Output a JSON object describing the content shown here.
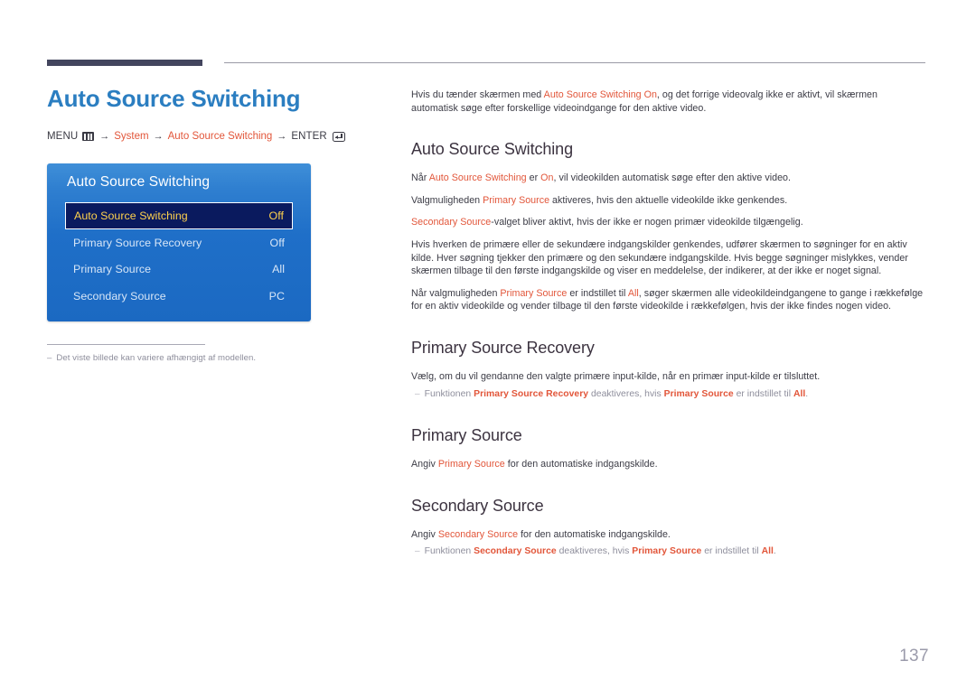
{
  "page_title": "Auto Source Switching",
  "breadcrumb": {
    "menu_label": "MENU",
    "menu_icon": "menu-bars-icon",
    "arrow": "→",
    "item1": "System",
    "item2": "Auto Source Switching",
    "enter_label": "ENTER",
    "enter_icon": "enter-return-icon"
  },
  "osd": {
    "title": "Auto Source Switching",
    "rows": [
      {
        "label": "Auto Source Switching",
        "value": "Off",
        "selected": true
      },
      {
        "label": "Primary Source Recovery",
        "value": "Off",
        "selected": false
      },
      {
        "label": "Primary Source",
        "value": "All",
        "selected": false
      },
      {
        "label": "Secondary Source",
        "value": "PC",
        "selected": false
      }
    ]
  },
  "footnote": {
    "dash": "‒",
    "text": "Det viste billede kan variere afhængigt af modellen."
  },
  "intro": {
    "p1_a": "Hvis du tænder skærmen med ",
    "p1_red": "Auto Source Switching On",
    "p1_b": ", og det forrige videovalg ikke er aktivt, vil skærmen automatisk søge efter forskellige videoindgange for den aktive video."
  },
  "sections": {
    "auto_source_switching": {
      "heading": "Auto Source Switching",
      "p1_a": "Når ",
      "p1_red1": "Auto Source Switching",
      "p1_b": " er ",
      "p1_red2": "On",
      "p1_c": ", vil videokilden automatisk søge efter den aktive video.",
      "p2_a": "Valgmuligheden ",
      "p2_red": "Primary Source",
      "p2_b": " aktiveres, hvis den aktuelle videokilde ikke genkendes.",
      "p3_red": "Secondary Source",
      "p3_b": "-valget bliver aktivt, hvis der ikke er nogen primær videokilde tilgængelig.",
      "p4": "Hvis hverken de primære eller de sekundære indgangskilder genkendes, udfører skærmen to søgninger for en aktiv kilde. Hver søgning tjekker den primære og den sekundære indgangskilde. Hvis begge søgninger mislykkes, vender skærmen tilbage til den første indgangskilde og viser en meddelelse, der indikerer, at der ikke er noget signal.",
      "p5_a": "Når valgmuligheden ",
      "p5_red1": "Primary Source",
      "p5_b": " er indstillet til ",
      "p5_red2": "All",
      "p5_c": ", søger skærmen alle videokildeindgangene to gange i rækkefølge for en aktiv videokilde og vender tilbage til den første videokilde i rækkefølgen, hvis der ikke findes nogen video."
    },
    "primary_source_recovery": {
      "heading": "Primary Source Recovery",
      "p1": "Vælg, om du vil gendanne den valgte primære input-kilde, når en primær input-kilde er tilsluttet.",
      "note_dash": "‒",
      "note_a": "Funktionen ",
      "note_red1": "Primary Source Recovery",
      "note_b": " deaktiveres, hvis ",
      "note_red2": "Primary Source",
      "note_c": " er indstillet til ",
      "note_red3": "All",
      "note_d": "."
    },
    "primary_source": {
      "heading": "Primary Source",
      "p1_a": "Angiv ",
      "p1_red": "Primary Source",
      "p1_b": " for den automatiske indgangskilde."
    },
    "secondary_source": {
      "heading": "Secondary Source",
      "p1_a": "Angiv ",
      "p1_red": "Secondary Source",
      "p1_b": " for den automatiske indgangskilde.",
      "note_dash": "‒",
      "note_a": "Funktionen ",
      "note_red1": "Secondary Source",
      "note_b": " deaktiveres, hvis ",
      "note_red2": "Primary Source",
      "note_c": " er indstillet til ",
      "note_red3": "All",
      "note_d": "."
    }
  },
  "page_number": "137",
  "colors": {
    "title_blue": "#2b7ec1",
    "accent_red": "#e2563a",
    "rule_navy": "#43455e",
    "osd_blue": "#1f6fc8",
    "osd_selected_bg": "#0a1a5e",
    "osd_selected_text": "#ffd24d",
    "heading_dark": "#3c3340",
    "note_gray": "#8e8e9c"
  }
}
